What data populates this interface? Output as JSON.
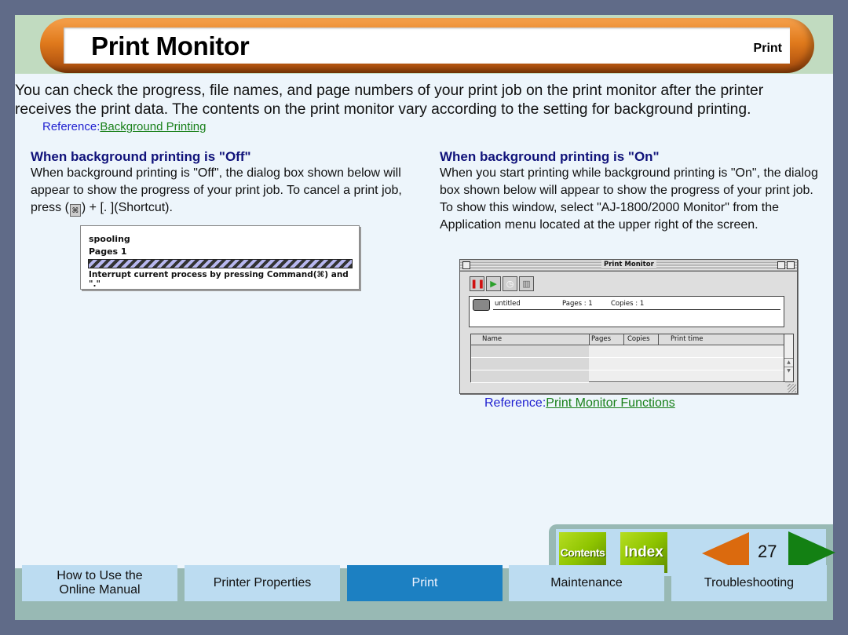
{
  "header": {
    "title": "Print Monitor",
    "section": "Print"
  },
  "intro": {
    "text": "You can check the progress, file names, and page numbers of your print job on the print monitor after the printer receives the print data. The contents on the print monitor vary according to the setting for background printing.",
    "reference_label": "Reference:",
    "reference_link": "Background Printing"
  },
  "off_section": {
    "heading": "When background printing is \"Off\"",
    "text_before": "When background printing is \"Off\", the dialog box shown below will appear to show the progress of your print job. To cancel a print job, press (",
    "cmd_symbol": "⌘",
    "text_after": ") + [. ](Shortcut).",
    "dialog": {
      "status": "spooling",
      "pages": "Pages 1",
      "hint": "Interrupt current process by pressing Command(⌘) and \".\""
    }
  },
  "on_section": {
    "heading": "When background printing is \"On\"",
    "text": "When you start printing while background printing is \"On\", the dialog box shown below will appear to show the progress of your print job. To show this window, select \"AJ-1800/2000 Monitor\" from the Application menu located at the upper right of the screen.",
    "window": {
      "title": "Print Monitor",
      "job_name": "untitled",
      "job_pages": "Pages : 1",
      "job_copies": "Copies : 1",
      "columns": [
        "Name",
        "Pages",
        "Copies",
        "Print time"
      ],
      "buttons": [
        "pause",
        "resume",
        "schedule",
        "delete"
      ]
    },
    "reference_label": "Reference:",
    "reference_link": "Print Monitor Functions"
  },
  "nav": {
    "contents": "Contents",
    "index": "Index",
    "page_number": "27"
  },
  "tabs": [
    {
      "label": "How to Use the Online Manual",
      "active": false
    },
    {
      "label": "Printer Properties",
      "active": false
    },
    {
      "label": "Print",
      "active": true
    },
    {
      "label": "Maintenance",
      "active": false
    },
    {
      "label": "Troubleshooting",
      "active": false
    }
  ]
}
